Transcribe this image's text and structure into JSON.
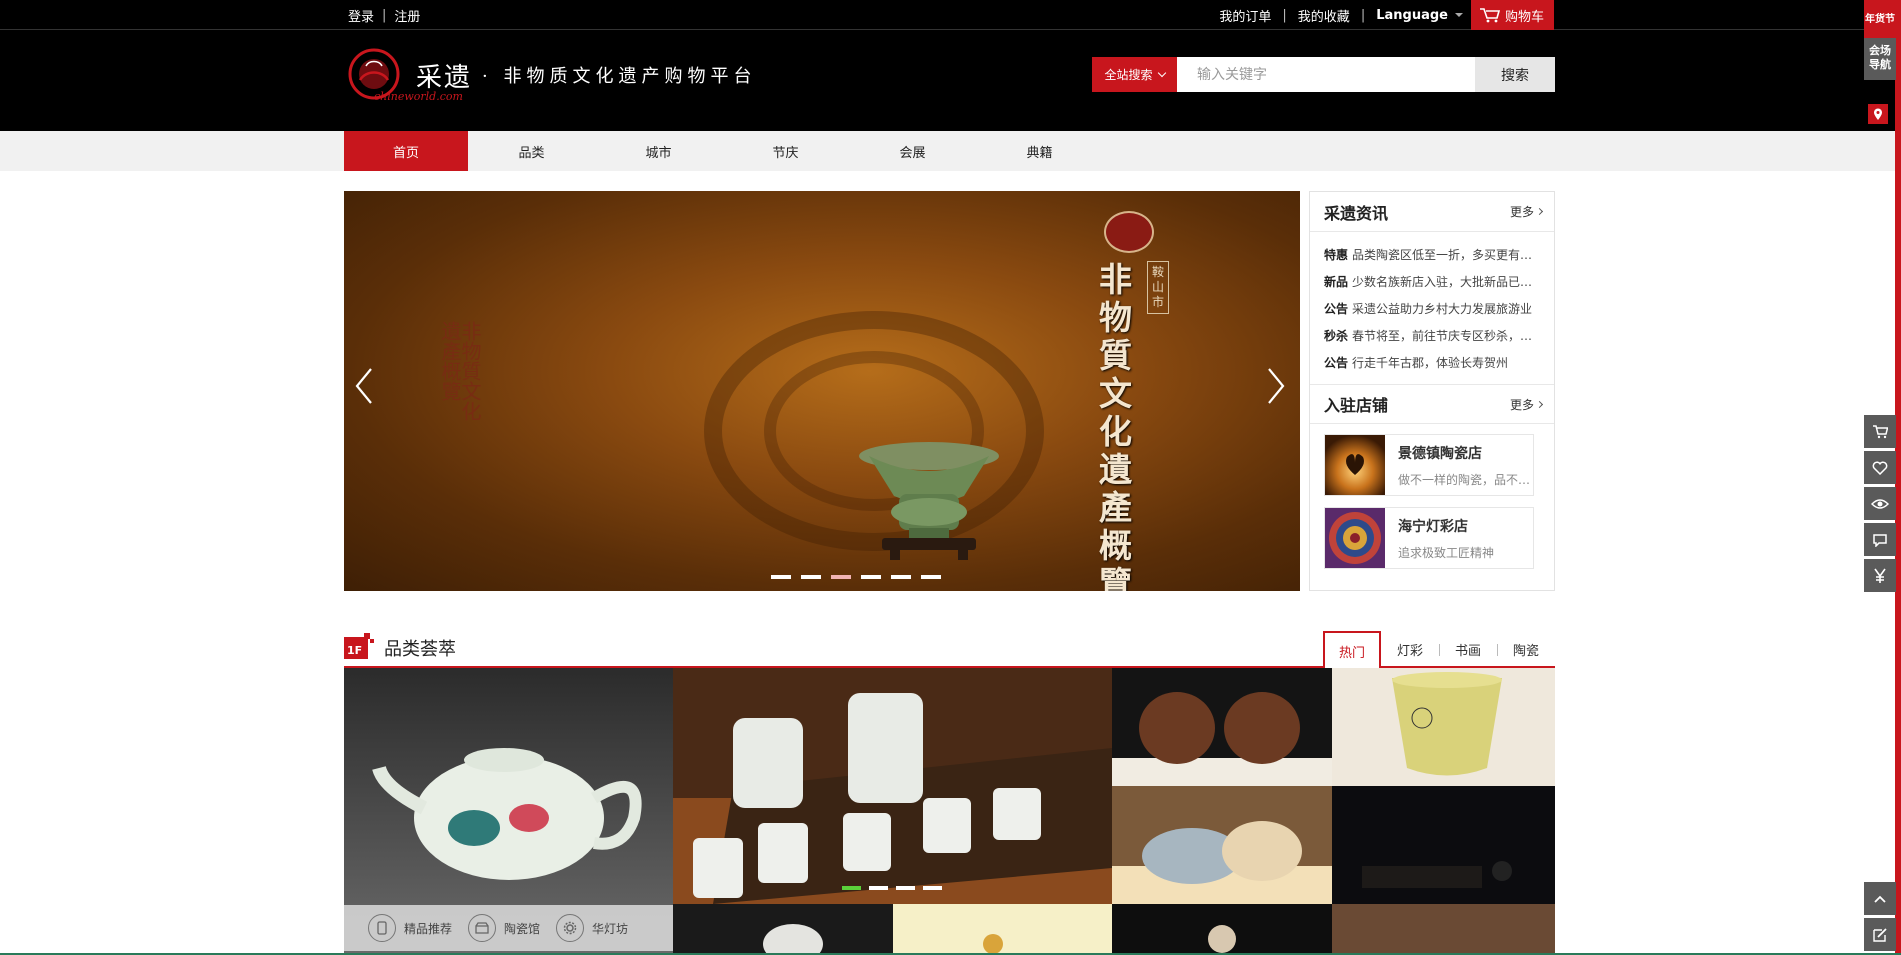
{
  "topbar": {
    "login": "登录",
    "register": "注册",
    "my_orders": "我的订单",
    "my_favorites": "我的收藏",
    "language": "Language",
    "cart": "购物车"
  },
  "header": {
    "logo_name": "采遗",
    "logo_slogan": "· 非物质文化遗产购物平台",
    "logo_url": "chineworld.com",
    "search_scope": "全站搜索",
    "search_placeholder": "输入关键字",
    "search_button": "搜索"
  },
  "nav": {
    "items": [
      {
        "label": "首页",
        "active": true
      },
      {
        "label": "品类",
        "active": false
      },
      {
        "label": "城市",
        "active": false
      },
      {
        "label": "节庆",
        "active": false
      },
      {
        "label": "会展",
        "active": false
      },
      {
        "label": "典籍",
        "active": false
      }
    ]
  },
  "banner": {
    "title_vertical": "非物質文化遺產概覽",
    "city_vertical": "鞍山市",
    "stamp": "非物質文化遺產概覽",
    "dots": 6,
    "active_dot": 3
  },
  "news": {
    "title": "采遗资讯",
    "more": "更多",
    "items": [
      {
        "tag": "特惠",
        "text": "品类陶瓷区低至一折，多买更有…"
      },
      {
        "tag": "新品",
        "text": "少数名族新店入驻，大批新品已…"
      },
      {
        "tag": "公告",
        "text": "采遗公益助力乡村大力发展旅游业"
      },
      {
        "tag": "秒杀",
        "text": "春节将至，前往节庆专区秒杀，…"
      },
      {
        "tag": "公告",
        "text": "行走千年古郡，体验长寿贺州"
      }
    ]
  },
  "shops": {
    "title": "入驻店铺",
    "more": "更多",
    "items": [
      {
        "name": "景德镇陶瓷店",
        "desc": "做不一样的陶瓷，品不…"
      },
      {
        "name": "海宁灯彩店",
        "desc": "追求极致工匠精神"
      }
    ]
  },
  "floor1": {
    "badge": "1F",
    "title": "品类荟萃",
    "tabs": [
      {
        "label": "热门",
        "active": true
      },
      {
        "label": "灯彩",
        "active": false
      },
      {
        "label": "书画",
        "active": false
      },
      {
        "label": "陶瓷",
        "active": false
      }
    ],
    "subnav": [
      {
        "label": "精品推荐",
        "icon": "phone-icon"
      },
      {
        "label": "陶瓷馆",
        "icon": "shop-icon"
      },
      {
        "label": "华灯坊",
        "icon": "gear-icon"
      }
    ]
  },
  "side": {
    "badge": "年货节",
    "nav_label": "会场导航"
  },
  "colors": {
    "brand_red": "#c8161d",
    "black": "#000000",
    "nav_gray": "#f1f1f1"
  }
}
